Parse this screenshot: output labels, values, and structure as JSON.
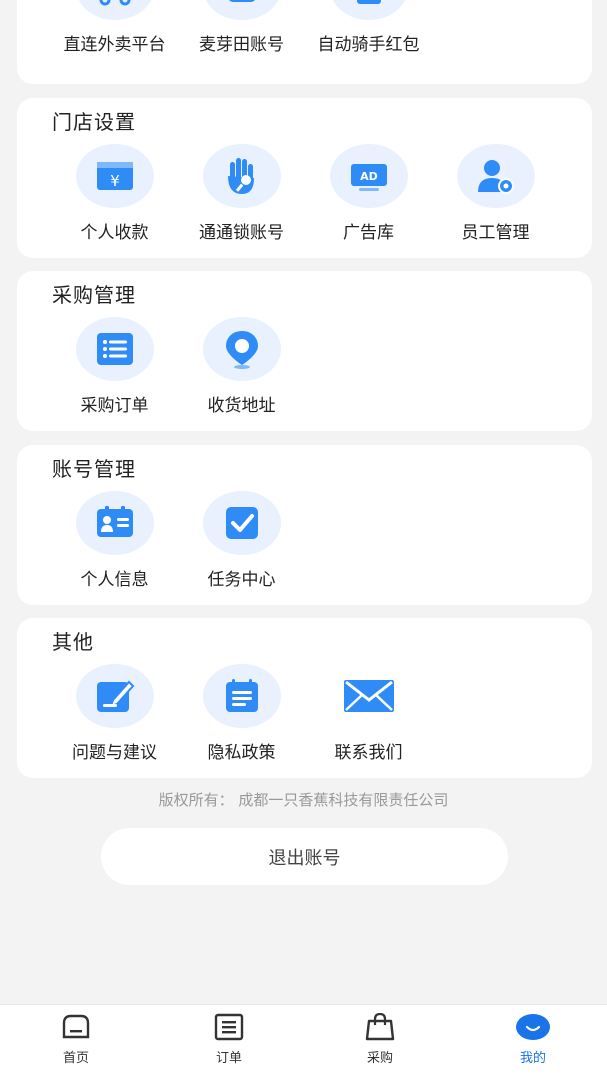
{
  "colors": {
    "accent": "#1a73e8",
    "icon_bg": "#e8f1fd",
    "icon_blue": "#2f8cf7"
  },
  "top_section": {
    "items": [
      {
        "label": "直连外卖平台",
        "icon": "delivery-platform-icon"
      },
      {
        "label": "麦芽田账号",
        "icon": "maiyatian-account-icon"
      },
      {
        "label": "自动骑手红包",
        "icon": "rider-red-packet-icon"
      }
    ]
  },
  "store_settings": {
    "title": "门店设置",
    "items": [
      {
        "label": "个人收款",
        "icon": "payment-card-icon"
      },
      {
        "label": "通通锁账号",
        "icon": "hand-key-icon"
      },
      {
        "label": "广告库",
        "icon": "ad-icon"
      },
      {
        "label": "员工管理",
        "icon": "staff-settings-icon"
      }
    ]
  },
  "purchase": {
    "title": "采购管理",
    "items": [
      {
        "label": "采购订单",
        "icon": "list-icon"
      },
      {
        "label": "收货地址",
        "icon": "location-pin-icon"
      }
    ]
  },
  "account": {
    "title": "账号管理",
    "items": [
      {
        "label": "个人信息",
        "icon": "id-card-icon"
      },
      {
        "label": "任务中心",
        "icon": "check-box-icon"
      }
    ]
  },
  "other": {
    "title": "其他",
    "items": [
      {
        "label": "问题与建议",
        "icon": "feedback-edit-icon"
      },
      {
        "label": "隐私政策",
        "icon": "document-icon"
      },
      {
        "label": "联系我们",
        "icon": "mail-icon"
      }
    ]
  },
  "copyright": "版权所有：  成都一只香蕉科技有限责任公司",
  "logout_label": "退出账号",
  "tabbar": {
    "tabs": [
      {
        "label": "首页",
        "icon": "home-icon"
      },
      {
        "label": "订单",
        "icon": "orders-icon"
      },
      {
        "label": "采购",
        "icon": "shopping-bag-icon"
      },
      {
        "label": "我的",
        "icon": "profile-icon",
        "active": true
      }
    ]
  }
}
